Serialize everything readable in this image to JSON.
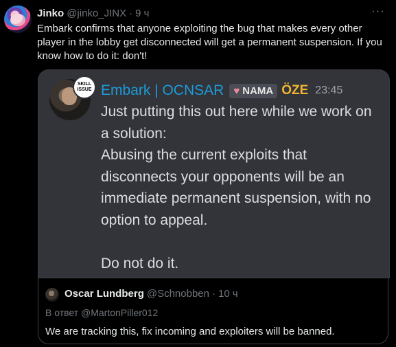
{
  "tweet": {
    "author_name": "Jinko",
    "author_handle": "@jinko_JINX",
    "separator": "·",
    "time": "9 ч",
    "more_icon": "more-horizontal-icon",
    "text": "Embark confirms that anyone exploiting the bug that makes every other player in the lobby get disconnected will get a permanent suspension. If you know how to do it: don't!"
  },
  "embed": {
    "author": "Embark | OCNSAR",
    "badge_text": "SKILL ISSUE",
    "tag_icon": "heart-icon",
    "tag": "NAMA",
    "wolf_icon": "ÖZE",
    "time": "23:45",
    "body": "Just putting this out here while we work on a solution:\nAbusing the current exploits that disconnects your opponents will be an immediate permanent suspension, with no option to appeal.\n\nDo not do it."
  },
  "quote": {
    "author_name": "Oscar Lundberg",
    "author_handle": "@Schnobben",
    "separator": "·",
    "time": "10 ч",
    "reply_to": "В ответ @MartonPiller012",
    "text": "We are tracking this, fix incoming and exploiters will be banned."
  },
  "colors": {
    "background": "#000000",
    "discord_panel": "#32343a",
    "discord_author": "#1e9ad6",
    "muted_text": "#71767b"
  }
}
